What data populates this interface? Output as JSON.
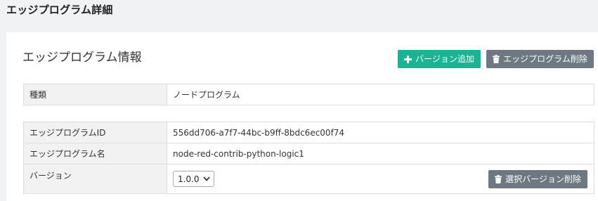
{
  "page": {
    "title": "エッジプログラム詳細"
  },
  "section": {
    "title": "エッジプログラム情報"
  },
  "buttons": {
    "add_version": "バージョン追加",
    "delete_program": "エッジプログラム削除",
    "delete_selected_version": "選択バージョン削除"
  },
  "type_row": {
    "label": "種類",
    "value": "ノードプログラム"
  },
  "details": [
    {
      "label": "エッジプログラムID",
      "value": "556dd706-a7f7-44bc-b9ff-8bdc6ec00f74"
    },
    {
      "label": "エッジプログラム名",
      "value": "node-red-contrib-python-logic1"
    }
  ],
  "version": {
    "label": "バージョン",
    "selected": "1.0.0"
  },
  "colors": {
    "accent_green": "#1ab394",
    "gray_button": "#6e7882"
  },
  "icons": {
    "add": "plus-icon",
    "delete": "trash-icon",
    "select": "chevron-down-icon"
  }
}
